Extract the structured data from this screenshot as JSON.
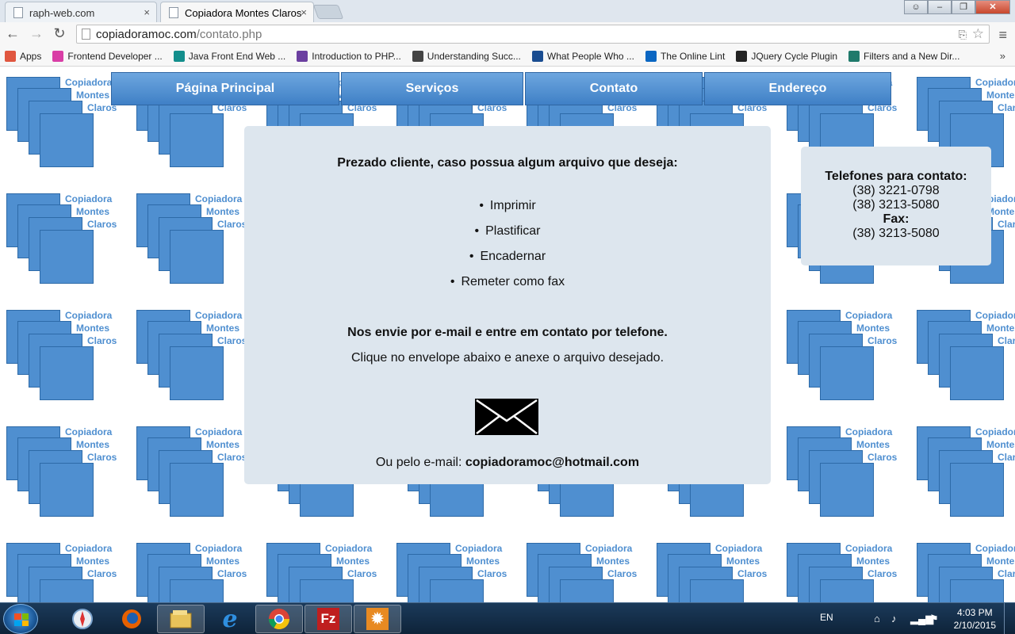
{
  "browser": {
    "tabs": [
      {
        "title": "raph-web.com",
        "active": false
      },
      {
        "title": "Copiadora Montes Claros",
        "active": true
      }
    ],
    "url_host": "copiadoramoc.com",
    "url_path": "/contato.php",
    "bookmarks": [
      {
        "label": "Apps",
        "icon": "apps-grid-icon",
        "color": "#e0563f"
      },
      {
        "label": "Frontend Developer ...",
        "icon": "frontend-icon",
        "color": "#d93ea6"
      },
      {
        "label": "Java Front End Web ...",
        "icon": "monster-icon",
        "color": "#138e8c"
      },
      {
        "label": "Introduction to PHP...",
        "icon": "m-icon",
        "color": "#6b3fa0"
      },
      {
        "label": "Understanding Succ...",
        "icon": "doc-icon",
        "color": "#444444"
      },
      {
        "label": "What People Who ...",
        "icon": "w3c-icon",
        "color": "#1a4d91"
      },
      {
        "label": "The Online Lint",
        "icon": "linkedin-icon",
        "color": "#0a66c2"
      },
      {
        "label": "JQuery Cycle Plugin",
        "icon": "jsl-icon",
        "color": "#222222"
      },
      {
        "label": "Filters and a New Dir...",
        "icon": "code-icon",
        "color": "#1f7a6b"
      }
    ],
    "bookmarks_more": "»"
  },
  "page": {
    "tile_label": [
      "Copiadora",
      "Montes",
      "Claros"
    ],
    "nav": [
      "Página Principal",
      "Serviços",
      "Contato",
      "Endereço"
    ],
    "content": {
      "intro": "Prezado cliente, caso possua algum arquivo que deseja:",
      "services": [
        "Imprimir",
        "Plastificar",
        "Encadernar",
        "Remeter como fax"
      ],
      "send_heading": "Nos envie por e-mail e entre em contato por telefone.",
      "click_text": "Clique no envelope abaixo e anexe o arquivo desejado.",
      "email_prefix": "Ou pelo e-mail: ",
      "email": "copiadoramoc@hotmail.com"
    },
    "contact": {
      "phones_label": "Telefones para contato:",
      "phone1": "(38) 3221-0798",
      "phone2": "(38) 3213-5080",
      "fax_label": "Fax:",
      "fax": "(38) 3213-5080"
    }
  },
  "taskbar": {
    "apps": [
      "safari-icon",
      "firefox-icon",
      "explorer-icon",
      "ie-icon",
      "chrome-icon",
      "filezilla-icon",
      "settings-icon"
    ],
    "lang": "EN",
    "time": "4:03 PM",
    "date": "2/10/2015"
  }
}
